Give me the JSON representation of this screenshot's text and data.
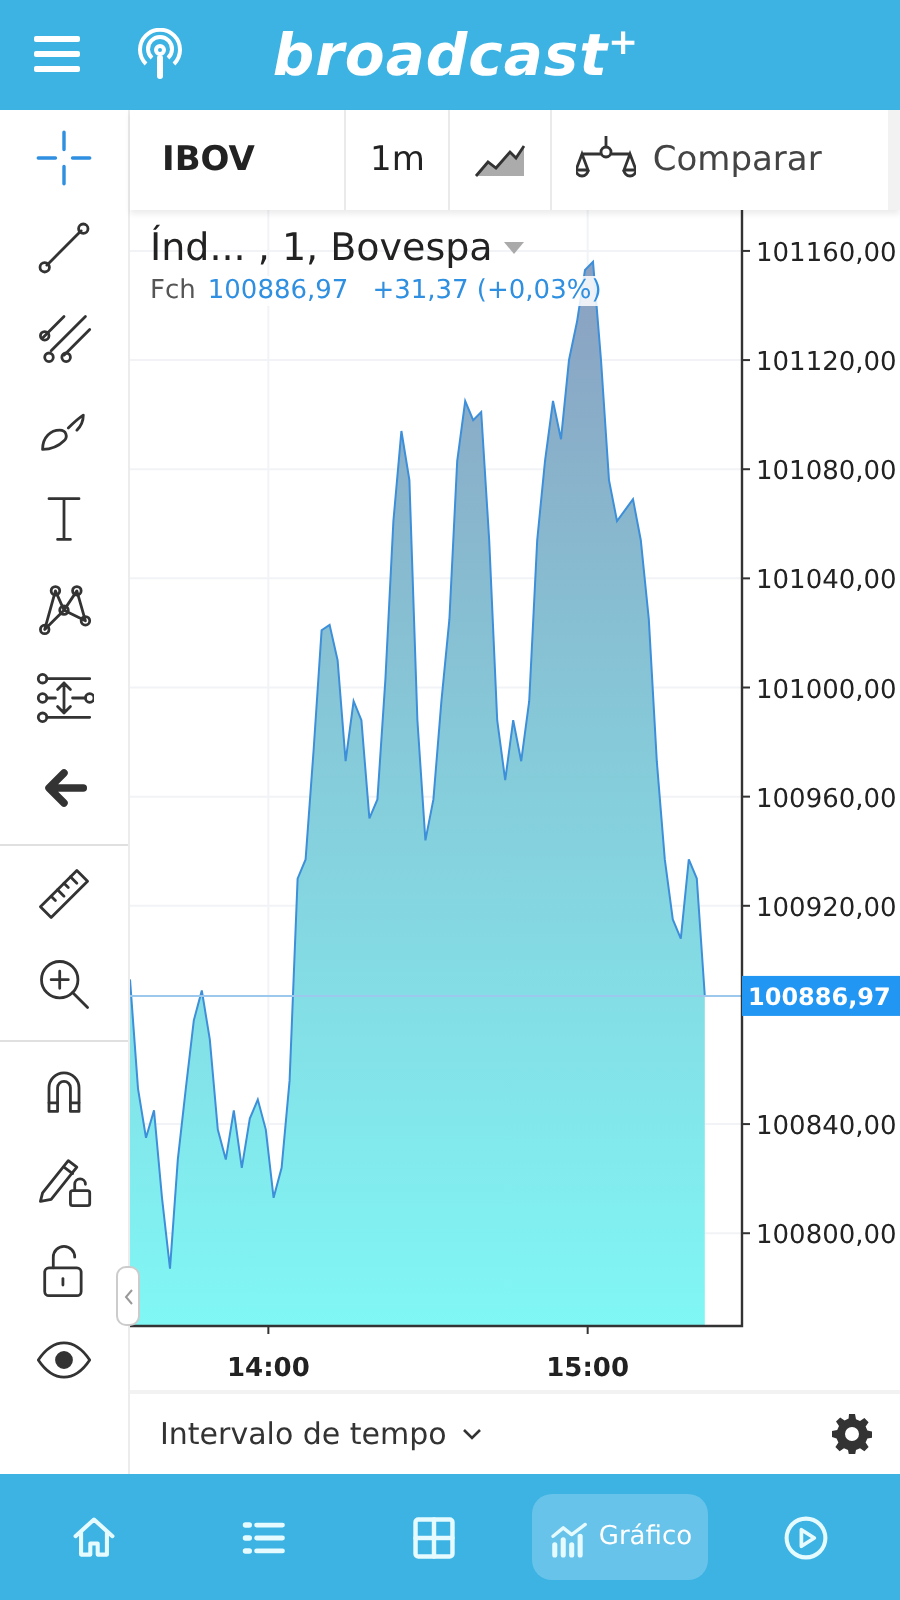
{
  "header": {
    "logo": "broadcast$^{+}$"
  },
  "tool_groups": [
    {
      "tools": [
        {
          "selected": true
        },
        {
          "selected": false
        },
        {
          "selected": false
        },
        {
          "selected": false
        },
        {
          "selected": false
        },
        {
          "selected": false
        },
        {
          "selected": false
        },
        {
          "selected": false
        }
      ]
    },
    {
      "tools": [
        {
          "selected": false
        },
        {
          "selected": false
        }
      ]
    },
    {
      "tools": [
        {
          "selected": false
        },
        {
          "selected": false
        },
        {
          "selected": false
        },
        {
          "selected": false
        }
      ]
    }
  ],
  "toolbar": {
    "symbol": "IBOV",
    "interval": "1m",
    "compare": "Comparar"
  },
  "chart": {
    "legend": {
      "name": "Índ... , 1, Bovespa",
      "close_label": "Fch",
      "close": "100886,97",
      "change": "+31,37 (+0,03%)"
    },
    "chart_data": {
      "type": "area",
      "grid": true,
      "ref_lines": [
        {
          "axis": "y",
          "value": 100886.97,
          "label": "100886,97",
          "color": "#9cc8ee"
        }
      ],
      "xlim": [
        814,
        929
      ],
      "ylim": [
        100766,
        101175
      ],
      "xticks": [
        {
          "value": 840,
          "label": "14:00"
        },
        {
          "value": 900,
          "label": "15:00"
        }
      ],
      "yticks": [
        {
          "value": 100800,
          "label": "100800,00"
        },
        {
          "value": 100840,
          "label": "100840,00"
        },
        {
          "value": 100920,
          "label": "100920,00"
        },
        {
          "value": 100960,
          "label": "100960,00"
        },
        {
          "value": 101000,
          "label": "101000,00"
        },
        {
          "value": 101040,
          "label": "101040,00"
        },
        {
          "value": 101080,
          "label": "101080,00"
        },
        {
          "value": 101120,
          "label": "101120,00"
        },
        {
          "value": 101160,
          "label": "101160,00"
        }
      ],
      "x": [
        814,
        815.5,
        817,
        818.5,
        820,
        821.5,
        823,
        824.5,
        826,
        827.5,
        829,
        830.5,
        832,
        833.5,
        835,
        836.5,
        838,
        839.5,
        841,
        842.5,
        844,
        845.5,
        847,
        848.5,
        850,
        851.5,
        853,
        854.5,
        856,
        857.5,
        859,
        860.5,
        862,
        863.5,
        865,
        866.5,
        868,
        869.5,
        871,
        872.5,
        874,
        875.5,
        877,
        878.5,
        880,
        881.5,
        883,
        884.5,
        886,
        887.5,
        889,
        890.5,
        892,
        893.5,
        895,
        896.5,
        898,
        899.5,
        901,
        902.5,
        904,
        905.5,
        907,
        908.5,
        910,
        911.5,
        913,
        914.5,
        916,
        917.5,
        919,
        920.5,
        922
      ],
      "series": [
        {
          "color": "#3d8fd9",
          "values": [
            100893,
            100853,
            100835,
            100845,
            100813,
            100787,
            100827,
            100853,
            100878,
            100889,
            100871,
            100838,
            100827,
            100845,
            100824,
            100842,
            100849,
            100838,
            100813,
            100824,
            100856,
            100930,
            100937,
            100977,
            101021,
            101023,
            101010,
            100973,
            100995,
            100988,
            100952,
            100959,
            101003,
            101061,
            101094,
            101076,
            100988,
            100944,
            100959,
            100995,
            101025,
            101083,
            101105,
            101098,
            101101,
            101054,
            100988,
            100966,
            100988,
            100973,
            100995,
            101054,
            101083,
            101105,
            101091,
            101120,
            101134,
            101153,
            101156,
            101120,
            101076,
            101061,
            101065,
            101069,
            101054,
            101025,
            100973,
            100937,
            100915,
            100908,
            100937,
            100930,
            100887
          ]
        }
      ]
    }
  },
  "footer": {
    "range": "Intervalo de tempo"
  },
  "nav": [
    {
      "selected": false
    },
    {
      "selected": false
    },
    {
      "selected": false
    },
    {
      "label": "Gráfico",
      "selected": true
    },
    {
      "selected": false
    }
  ]
}
